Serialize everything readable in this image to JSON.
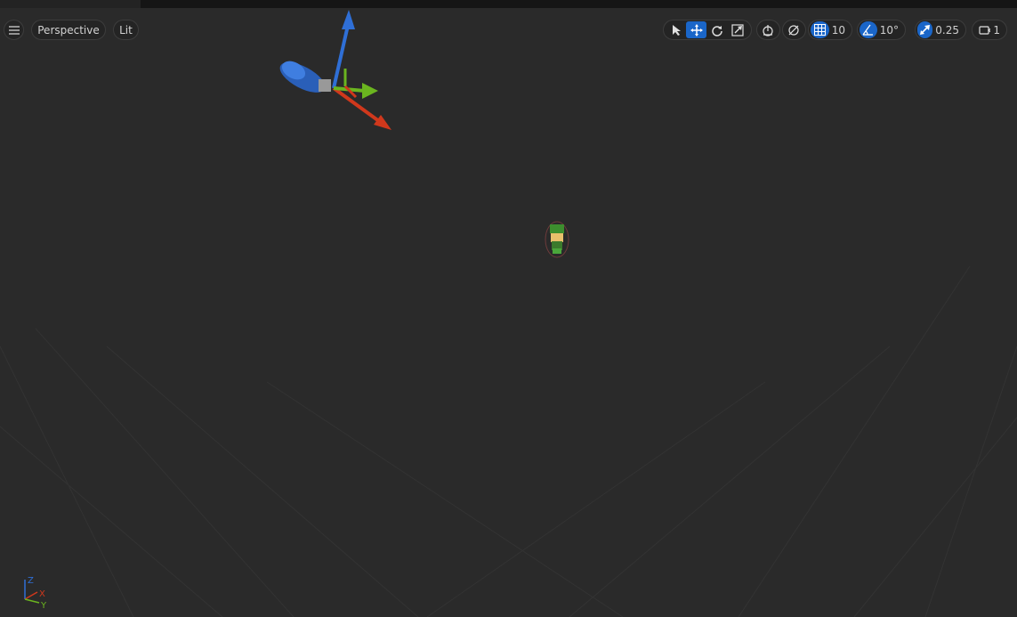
{
  "viewport": {
    "view_mode": "Perspective",
    "lighting_mode": "Lit"
  },
  "toolbar": {
    "tools": [
      "select-icon",
      "translate-icon",
      "rotate-icon",
      "scale-icon"
    ],
    "active_tool": "translate-icon",
    "grid_snap_value": "10",
    "rotation_snap_value": "10°",
    "scale_snap_value": "0.25",
    "camera_speed_value": "1"
  },
  "axis_widget": {
    "z_label": "Z",
    "x_label": "X",
    "y_label": "Y"
  },
  "colors": {
    "accent": "#1a66c9",
    "background": "#2a2a2a",
    "axis_x": "#d0381c",
    "axis_y": "#6bb51f",
    "axis_z": "#2f6fd6"
  }
}
